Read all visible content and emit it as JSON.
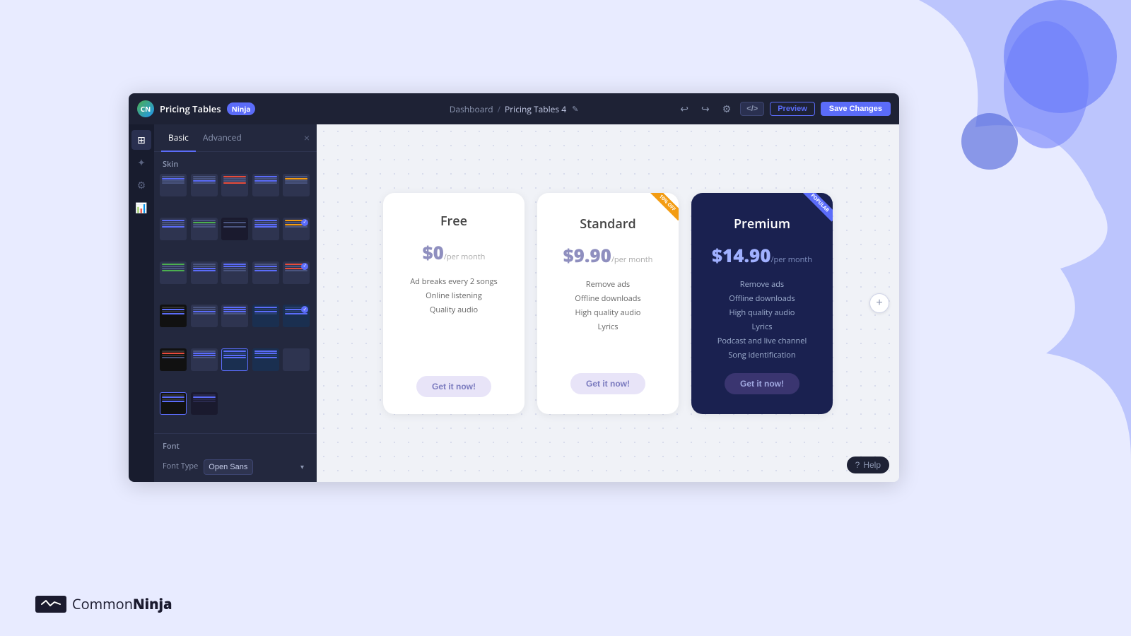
{
  "app": {
    "title": "Pricing Tables",
    "badge": "Ninja",
    "logo_initials": "CN"
  },
  "breadcrumb": {
    "dashboard": "Dashboard",
    "separator": "/",
    "current": "Pricing Tables 4"
  },
  "toolbar": {
    "code_label": "</>",
    "preview_label": "Preview",
    "save_label": "Save Changes"
  },
  "panel": {
    "tab_basic": "Basic",
    "tab_advanced": "Advanced",
    "skin_section": "Skin",
    "font_section": "Font",
    "font_type_label": "Font Type",
    "font_selected": "Open Sans"
  },
  "pricing": {
    "free": {
      "title": "Free",
      "price": "$0",
      "period": "/per month",
      "features": [
        "Ad breaks every 2 songs",
        "Online listening",
        "Quality audio"
      ],
      "cta": "Get it now!"
    },
    "standard": {
      "title": "Standard",
      "price": "$9.90",
      "period": "/per month",
      "features": [
        "Remove ads",
        "Offline downloads",
        "High quality audio",
        "Lyrics"
      ],
      "cta": "Get it now!",
      "ribbon": "10% OFF"
    },
    "premium": {
      "title": "Premium",
      "price": "$14.90",
      "period": "/per month",
      "features": [
        "Remove ads",
        "Offline downloads",
        "High quality audio",
        "Lyrics",
        "Podcast and live channel",
        "Song identification"
      ],
      "cta": "Get it now!",
      "ribbon": "POPULAR"
    }
  },
  "help_label": "Help",
  "brand": {
    "name_light": "Common",
    "name_bold": "Ninja"
  },
  "add_column": "+",
  "icons": {
    "grid": "⊞",
    "brush": "🎨",
    "gear": "⚙",
    "chart": "📊",
    "close": "×",
    "undo": "↩",
    "redo": "↪",
    "settings": "⚙",
    "help": "?"
  }
}
